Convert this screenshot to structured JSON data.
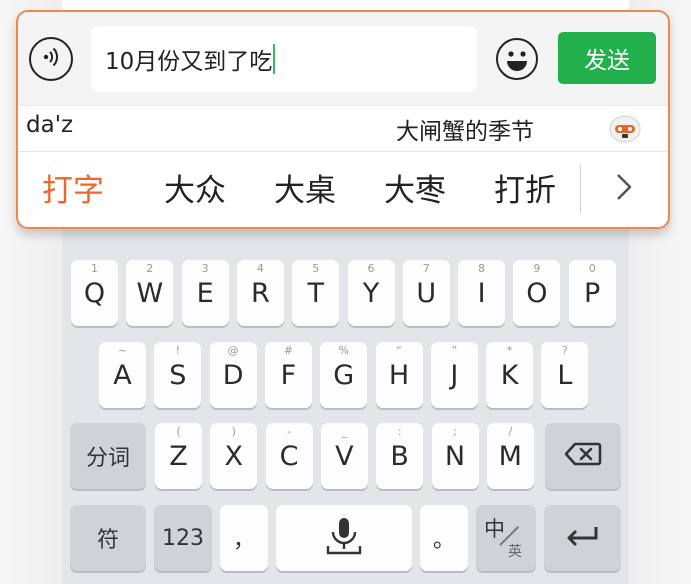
{
  "input_panel": {
    "message_text": "10月份又到了吃",
    "send_label": "发送",
    "pinyin": "da'z",
    "hint": "大闸蟹的季节",
    "candidates": [
      "打字",
      "大众",
      "大桌",
      "大枣",
      "打折"
    ],
    "accent_color": "#f0884a",
    "send_color": "#21b04b"
  },
  "keyboard": {
    "row1": [
      {
        "key": "Q",
        "sub": "1"
      },
      {
        "key": "W",
        "sub": "2"
      },
      {
        "key": "E",
        "sub": "3"
      },
      {
        "key": "R",
        "sub": "4"
      },
      {
        "key": "T",
        "sub": "5"
      },
      {
        "key": "Y",
        "sub": "6"
      },
      {
        "key": "U",
        "sub": "7"
      },
      {
        "key": "I",
        "sub": "8"
      },
      {
        "key": "O",
        "sub": "9"
      },
      {
        "key": "P",
        "sub": "0"
      }
    ],
    "row2": [
      {
        "key": "A",
        "sub": "~"
      },
      {
        "key": "S",
        "sub": "!"
      },
      {
        "key": "D",
        "sub": "@"
      },
      {
        "key": "F",
        "sub": "#"
      },
      {
        "key": "G",
        "sub": "%"
      },
      {
        "key": "H",
        "sub": "“"
      },
      {
        "key": "J",
        "sub": "”"
      },
      {
        "key": "K",
        "sub": "*"
      },
      {
        "key": "L",
        "sub": "?"
      }
    ],
    "row3": [
      {
        "key": "Z",
        "sub": "("
      },
      {
        "key": "X",
        "sub": ")"
      },
      {
        "key": "C",
        "sub": "-"
      },
      {
        "key": "V",
        "sub": "_"
      },
      {
        "key": "B",
        "sub": ":"
      },
      {
        "key": "N",
        "sub": ";"
      },
      {
        "key": "M",
        "sub": "/"
      }
    ],
    "segment_label": "分词",
    "symbol_label": "符",
    "number_label": "123",
    "comma_label": "，",
    "period_label": "。",
    "lang_main": "中",
    "lang_sub": "英"
  }
}
